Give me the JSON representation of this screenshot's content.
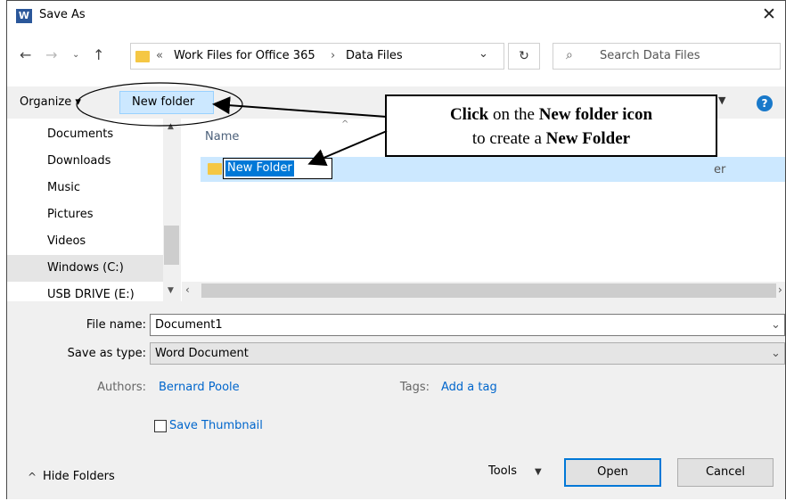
{
  "window": {
    "title": "Save As",
    "app_icon": "word-icon",
    "app_icon_letter": "W"
  },
  "address_bar": {
    "crumbs": [
      "Work Files for Office 365",
      "Data Files"
    ],
    "overflow_glyph": "«",
    "separator": "›"
  },
  "search": {
    "placeholder": "Search Data Files"
  },
  "toolbar": {
    "organize_label": "Organize ▾",
    "new_folder_label": "New folder",
    "help_label": "?"
  },
  "nav_pane": {
    "items": [
      {
        "label": "Documents",
        "icon": "documents-icon"
      },
      {
        "label": "Downloads",
        "icon": "downloads-icon"
      },
      {
        "label": "Music",
        "icon": "music-icon"
      },
      {
        "label": "Pictures",
        "icon": "pictures-icon"
      },
      {
        "label": "Videos",
        "icon": "videos-icon"
      },
      {
        "label": "Windows (C:)",
        "icon": "drive-icon",
        "selected": true
      },
      {
        "label": "USB DRIVE (E:)",
        "icon": "usb-drive-icon"
      }
    ]
  },
  "file_list": {
    "column_header": "Name",
    "rows": [
      {
        "name": "New Folder",
        "editing": true,
        "trailing_text": "er"
      }
    ]
  },
  "form": {
    "file_name_label": "File name:",
    "file_name_value": "Document1",
    "save_type_label": "Save as type:",
    "save_type_value": "Word Document",
    "authors_label": "Authors:",
    "authors_value": "Bernard Poole",
    "tags_label": "Tags:",
    "tags_value": "Add a tag",
    "thumbnail_label": "Save Thumbnail",
    "thumbnail_checked": false
  },
  "footer": {
    "hide_folders_label": "Hide Folders",
    "tools_label": "Tools",
    "open_label": "Open",
    "cancel_label": "Cancel"
  },
  "callout": {
    "line1_bold_a": "Click",
    "line1_plain": " on the ",
    "line1_bold_b": "New folder icon",
    "line2_plain": "to create a ",
    "line2_bold": "New Folder"
  },
  "colors": {
    "accent": "#0078d7",
    "selection": "#cce8ff",
    "link": "#0066cc",
    "folder": "#f5c744",
    "word_blue": "#2b579a"
  }
}
